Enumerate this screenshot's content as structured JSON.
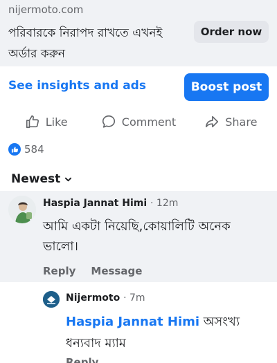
{
  "ad": {
    "domain": "nijermoto.com",
    "headline": "পরিবারকে নিরাপদ রাখতে এখনই অর্ডার করুন",
    "cta_label": "Order now"
  },
  "insights": {
    "link_label": "See insights and ads",
    "boost_label": "Boost post"
  },
  "actions": {
    "like_label": "Like",
    "comment_label": "Comment",
    "share_label": "Share"
  },
  "reactions": {
    "count": "584"
  },
  "sort": {
    "label": "Newest"
  },
  "comment": {
    "author": "Haspia Jannat Himi",
    "time": "· 12m",
    "text": "আমি একটা নিয়েছি,কোয়ালিটি অনেক ভালো।",
    "reply_label": "Reply",
    "message_label": "Message"
  },
  "reply": {
    "author": "Nijermoto",
    "time": "· 7m",
    "mention": "Haspia Jannat Himi",
    "text": "অসংখ্য ধন্যবাদ ম্যাম",
    "reply_label": "Reply"
  },
  "colors": {
    "accent": "#1877f2",
    "muted_text": "#65676b",
    "panel_bg": "#f0f2f5"
  }
}
